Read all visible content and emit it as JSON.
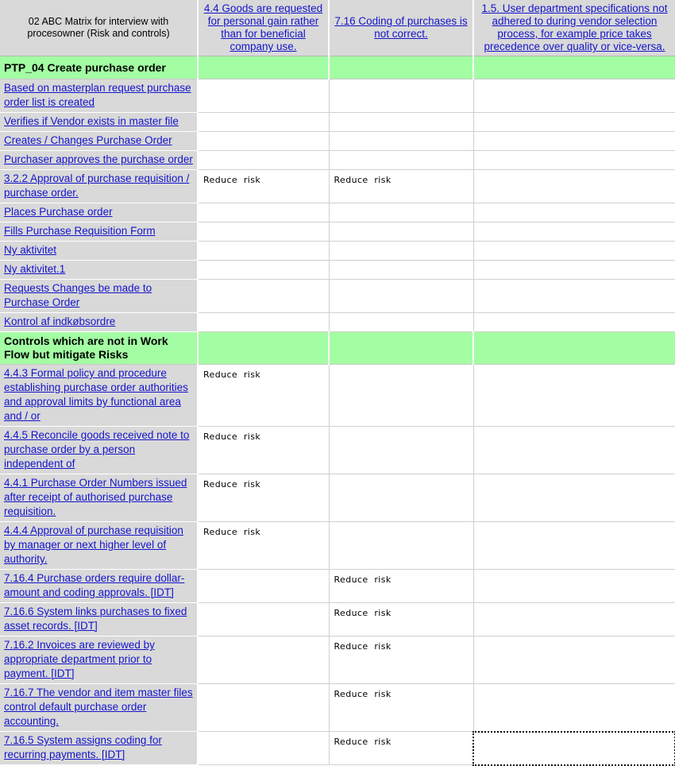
{
  "header": {
    "corner_title": "02 ABC Matrix for interview with procesowner (Risk and controls)",
    "risk_columns": [
      "4.4 Goods are requested for personal gain rather than for beneficial company use.",
      "7.16 Coding of purchases is not correct.",
      "1.5. User department specifications not adhered to during vendor selection process, for example price takes precedence over quality or vice-versa."
    ]
  },
  "sections": [
    {
      "title": "PTP_04 Create purchase order",
      "rows": [
        {
          "label": "Based on masterplan request purchase order list is created",
          "values": [
            "",
            "",
            ""
          ]
        },
        {
          "label": "Verifies if Vendor exists in master file",
          "values": [
            "",
            "",
            ""
          ]
        },
        {
          "label": "Creates / Changes Purchase Order",
          "values": [
            "",
            "",
            ""
          ]
        },
        {
          "label": "Purchaser approves the purchase order",
          "values": [
            "",
            "",
            ""
          ]
        },
        {
          "label": "3.2.2 Approval of purchase requisition / purchase order.",
          "values": [
            "Reduce  risk",
            "Reduce  risk",
            ""
          ]
        },
        {
          "label": "Places Purchase order",
          "values": [
            "",
            "",
            ""
          ]
        },
        {
          "label": "Fills Purchase Requisition Form",
          "values": [
            "",
            "",
            ""
          ]
        },
        {
          "label": "Ny aktivitet",
          "values": [
            "",
            "",
            ""
          ]
        },
        {
          "label": "Ny aktivitet.1",
          "values": [
            "",
            "",
            ""
          ]
        },
        {
          "label": "Requests Changes be made to Purchase Order",
          "values": [
            "",
            "",
            ""
          ]
        },
        {
          "label": "Kontrol af indkøbsordre",
          "values": [
            "",
            "",
            ""
          ]
        }
      ]
    },
    {
      "title": "Controls which are not in Work Flow but mitigate Risks",
      "rows": [
        {
          "label": "4.4.3 Formal policy and procedure establishing purchase order authorities and approval limits by functional area and / or",
          "values": [
            "Reduce  risk",
            "",
            ""
          ]
        },
        {
          "label": "4.4.5 Reconcile goods received note to purchase order by a person independent of",
          "values": [
            "Reduce  risk",
            "",
            ""
          ]
        },
        {
          "label": "4.4.1 Purchase Order Numbers issued after receipt of authorised purchase requisition.",
          "values": [
            "Reduce  risk",
            "",
            ""
          ]
        },
        {
          "label": "4.4.4 Approval of purchase requisition by manager or next higher level of authority.",
          "values": [
            "Reduce  risk",
            "",
            ""
          ]
        },
        {
          "label": "7.16.4 Purchase orders require dollar-amount and coding approvals. [IDT]",
          "values": [
            "",
            "Reduce  risk",
            ""
          ]
        },
        {
          "label": "7.16.6 System links purchases to fixed asset records. [IDT]",
          "values": [
            "",
            "Reduce  risk",
            ""
          ]
        },
        {
          "label": "7.16.2 Invoices are reviewed by appropriate department prior to payment. [IDT]",
          "values": [
            "",
            "Reduce  risk",
            ""
          ]
        },
        {
          "label": "7.16.7 The vendor and item master files control default purchase order accounting.",
          "values": [
            "",
            "Reduce  risk",
            ""
          ]
        },
        {
          "label": "7.16.5 System assigns coding for recurring payments. [IDT]",
          "values": [
            "",
            "Reduce  risk",
            ""
          ]
        }
      ]
    }
  ],
  "selected_cell": {
    "section": 1,
    "row": 8,
    "column": 2
  },
  "colors": {
    "label_background": "#d9d9d9",
    "section_background": "#a3fda3",
    "link_text": "#1414cc",
    "cell_background": "#ffffff"
  }
}
